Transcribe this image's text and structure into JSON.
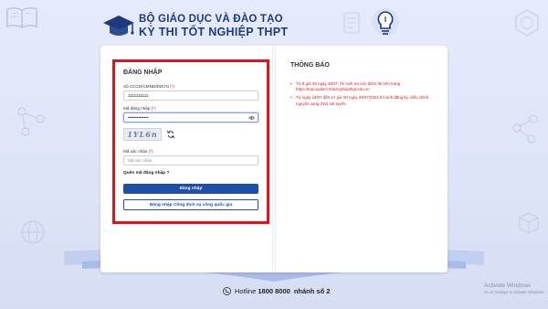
{
  "header": {
    "ministry": "BỘ GIÁO DỤC VÀ ĐÀO TẠO",
    "exam": "KỲ THI TỐT NGHIỆP THPT"
  },
  "login": {
    "title": "ĐĂNG NHẬP",
    "id_label": "Số CCCD/CMND/ĐDCN",
    "id_value": "1111111111",
    "password_label": "Mã đăng nhập",
    "password_value": "••••••••••••••",
    "captcha_text": "1YL6n",
    "captcha_label": "Mã xác nhận",
    "captcha_placeholder": "Mã xác nhận",
    "required_mark": "(*)",
    "forgot": "Quên mã đăng nhập ?",
    "submit": "Đăng nhập",
    "gov_login": "Đăng nhập Cổng dịch vụ công quốc gia"
  },
  "notice": {
    "title": "THÔNG BÁO",
    "items": [
      "Từ 8 giờ 00 ngày 18/07, thí sinh tra cứu điểm thi trên trang https://tracuudiem.thitotnghiepthpt.edu.vn",
      "Từ ngày 18/07 đến 17 giờ 00 ngày 28/07/2023 thí sinh đăng ký, điều chỉnh nguyện vọng (NV) xét tuyển."
    ]
  },
  "hotline": {
    "label": "Hotline",
    "number": "1800 8000",
    "suffix": "nhánh số 2"
  },
  "watermark": {
    "title": "Activate Windows",
    "subtitle": "Go to Settings to activate Windows."
  },
  "icons": {
    "logo": "graduation-cap-icon",
    "eye": "eye-icon",
    "refresh": "refresh-icon",
    "phone": "phone-icon"
  },
  "colors": {
    "brand": "#1e3a7b",
    "primary_button": "#1d4fa6",
    "highlight_border": "#e0141a",
    "notice_text": "#d31e1e"
  }
}
